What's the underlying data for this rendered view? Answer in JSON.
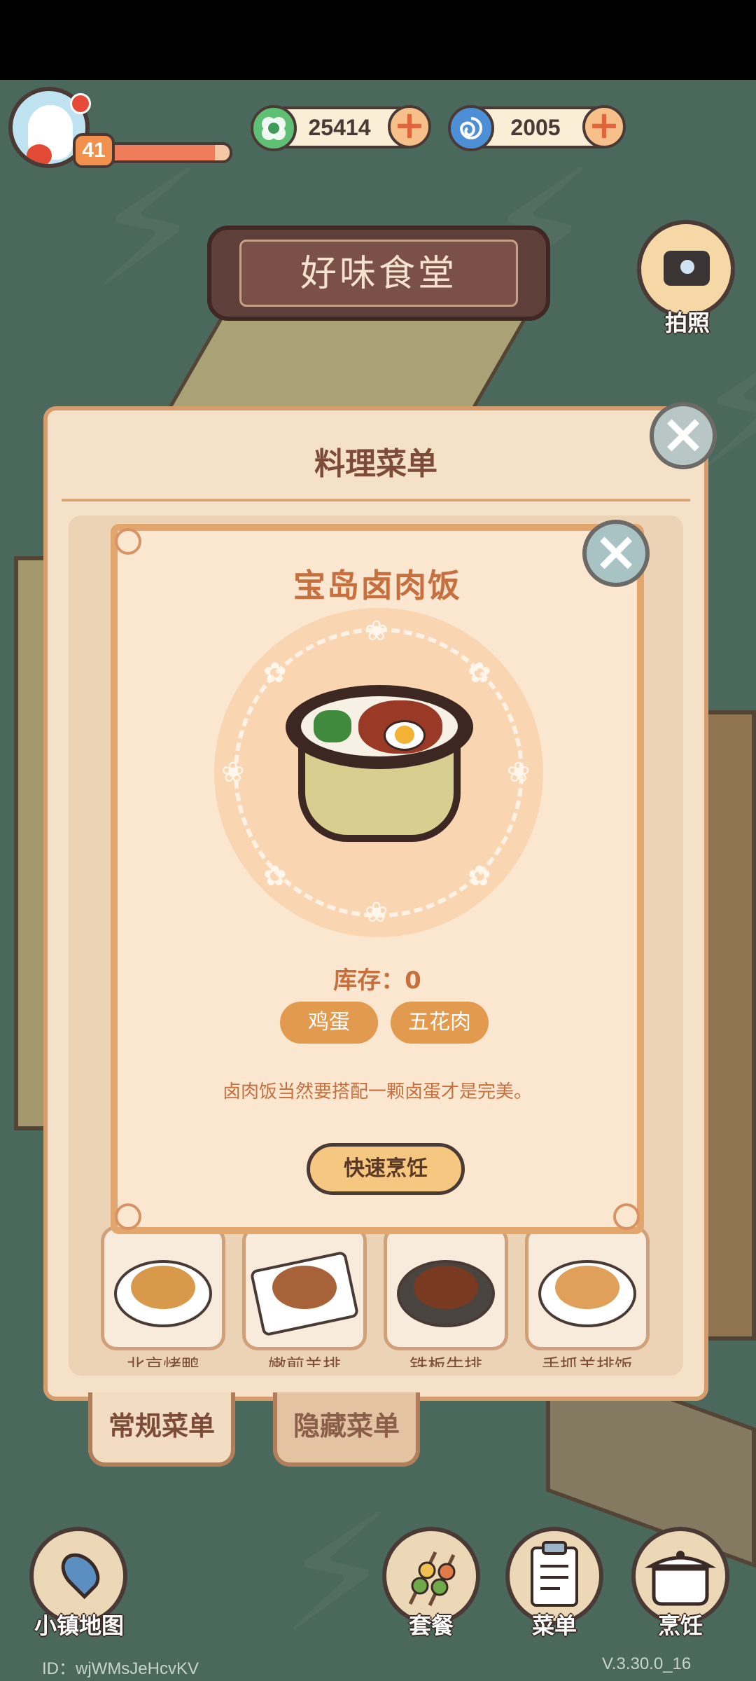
{
  "hud": {
    "level": "41",
    "xp_progress": 0.88,
    "currency_leaf": {
      "value": "25414",
      "icon": "clover-leaf-icon",
      "color": "#5fbf75"
    },
    "currency_swirl": {
      "value": "2005",
      "icon": "blue-swirl-icon",
      "color": "#4d8fd6"
    }
  },
  "restaurant_name": "好味食堂",
  "camera_label": "拍照",
  "menu_panel": {
    "title": "料理菜单",
    "dishes": [
      {
        "name": "北京烤鸭"
      },
      {
        "name": "嫩煎羊排"
      },
      {
        "name": "铁板牛排"
      },
      {
        "name": "手抓羊排饭"
      }
    ],
    "tabs": [
      "常规菜单",
      "隐藏菜单"
    ],
    "active_tab": "常规菜单"
  },
  "dish_detail": {
    "title": "宝岛卤肉饭",
    "stock_label": "库存：0",
    "ingredients": [
      "鸡蛋",
      "五花肉"
    ],
    "description": "卤肉饭当然要搭配一颗卤蛋才是完美。",
    "cook_button": "快速烹饪"
  },
  "bottom_nav": {
    "map": "小镇地图",
    "set_meal": "套餐",
    "menu": "菜单",
    "cook": "烹饪"
  },
  "footer": {
    "id": "ID：wjWMsJeHcvKV",
    "version": "V.3.30.0_16"
  },
  "colors": {
    "accent_orange": "#e29b4e",
    "title_brown": "#c66f3f",
    "background_teal": "#5e8070"
  }
}
